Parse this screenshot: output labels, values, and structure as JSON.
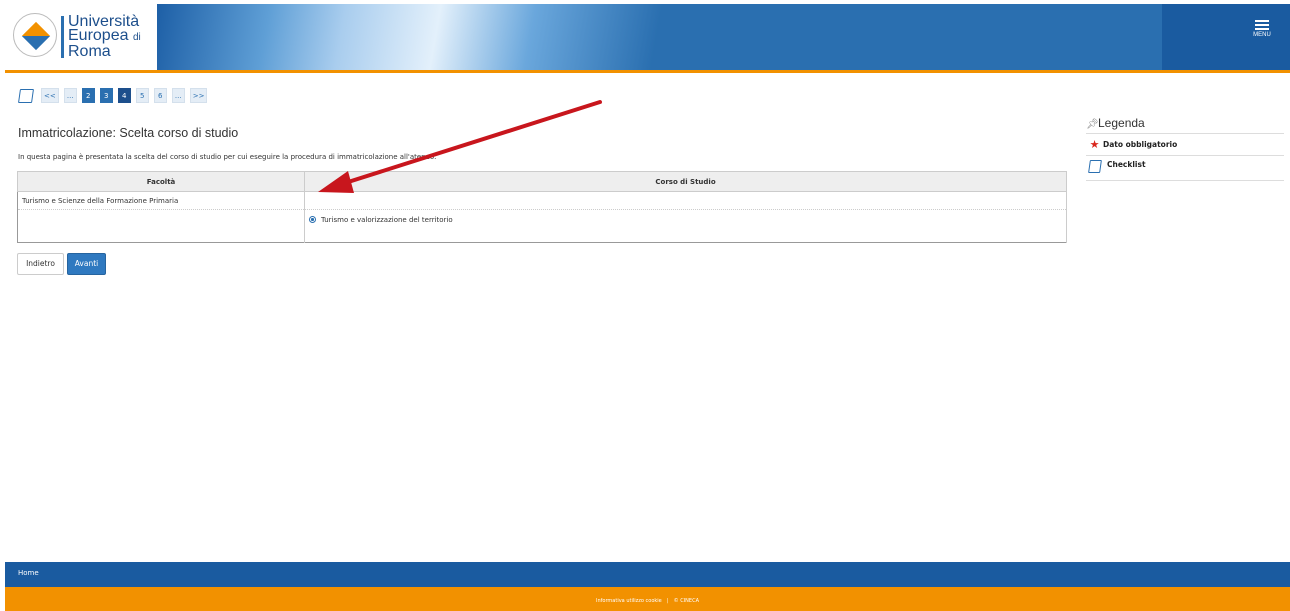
{
  "header": {
    "logo_line1": "Università",
    "logo_line2": "Europea",
    "logo_line2_suffix": "di",
    "logo_line3": "Roma",
    "menu_label": "MENU"
  },
  "pager": {
    "items": [
      {
        "label": "<<",
        "state": "link"
      },
      {
        "label": "...",
        "state": "link"
      },
      {
        "label": "2",
        "state": "done"
      },
      {
        "label": "3",
        "state": "done"
      },
      {
        "label": "4",
        "state": "current"
      },
      {
        "label": "5",
        "state": "link"
      },
      {
        "label": "6",
        "state": "link"
      },
      {
        "label": "...",
        "state": "link"
      },
      {
        "label": ">>",
        "state": "link"
      }
    ]
  },
  "main": {
    "title": "Immatricolazione: Scelta corso di studio",
    "intro": "In questa pagina è presentata la scelta del corso di studio per cui eseguire la procedura di immatricolazione all'ateneo.",
    "table": {
      "headers": [
        "Facoltà",
        "Corso di Studio"
      ],
      "faculty": "Turismo e Scienze della Formazione Primaria",
      "course_option": "Turismo e valorizzazione del territorio"
    },
    "back_label": "Indietro",
    "next_label": "Avanti"
  },
  "legend": {
    "title": "Legenda",
    "items": [
      "Dato obbligatorio",
      "Checklist"
    ]
  },
  "footer": {
    "home_label": "Home",
    "cookie_label": "Informativa utilizzo cookie",
    "separator": "|",
    "copyright": "© CINECA"
  },
  "colors": {
    "primary": "#2a6fb0",
    "accent": "#f29100",
    "annotation_arrow": "#c8161d"
  }
}
